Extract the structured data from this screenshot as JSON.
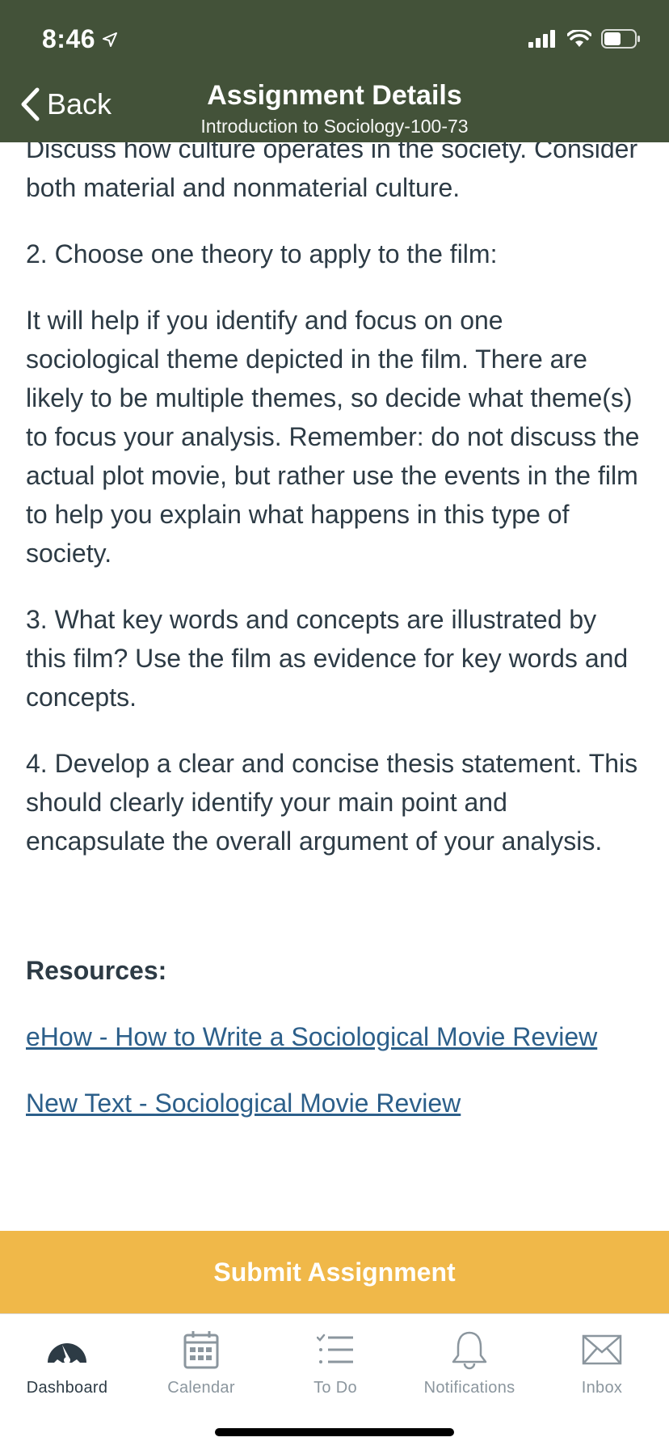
{
  "status_bar": {
    "time": "8:46"
  },
  "header": {
    "back_label": "Back",
    "title": "Assignment Details",
    "subtitle": "Introduction to Sociology-100-73"
  },
  "content": {
    "paragraphs": [
      "Discuss how culture operates in the society. Consider both material and nonmaterial culture.",
      "2. Choose one theory to apply to the film:",
      "It will help if you identify and focus on one sociological theme depicted in the film. There are likely to be multiple themes, so decide what theme(s) to focus your analysis. Remember: do not discuss the actual plot movie, but rather use the events in the film to help you explain what happens in this type of society.",
      "3. What key words and concepts are illustrated by this film? Use the film as evidence for key words and concepts.",
      "4. Develop a clear and concise thesis statement. This should clearly identify your main point and encapsulate the overall argument of your analysis."
    ],
    "resources_heading": "Resources:",
    "links": [
      "eHow - How to Write a Sociological Movie Review",
      "New Text - Sociological Movie Review"
    ]
  },
  "submit_label": "Submit Assignment",
  "tabs": [
    {
      "label": "Dashboard",
      "icon": "dashboard-icon",
      "active": true
    },
    {
      "label": "Calendar",
      "icon": "calendar-icon",
      "active": false
    },
    {
      "label": "To Do",
      "icon": "todo-icon",
      "active": false
    },
    {
      "label": "Notifications",
      "icon": "bell-icon",
      "active": false
    },
    {
      "label": "Inbox",
      "icon": "mail-icon",
      "active": false
    }
  ],
  "colors": {
    "header_bg": "#435239",
    "submit_bg": "#f0b849",
    "link": "#2c5f8a",
    "text": "#2d3b45"
  }
}
